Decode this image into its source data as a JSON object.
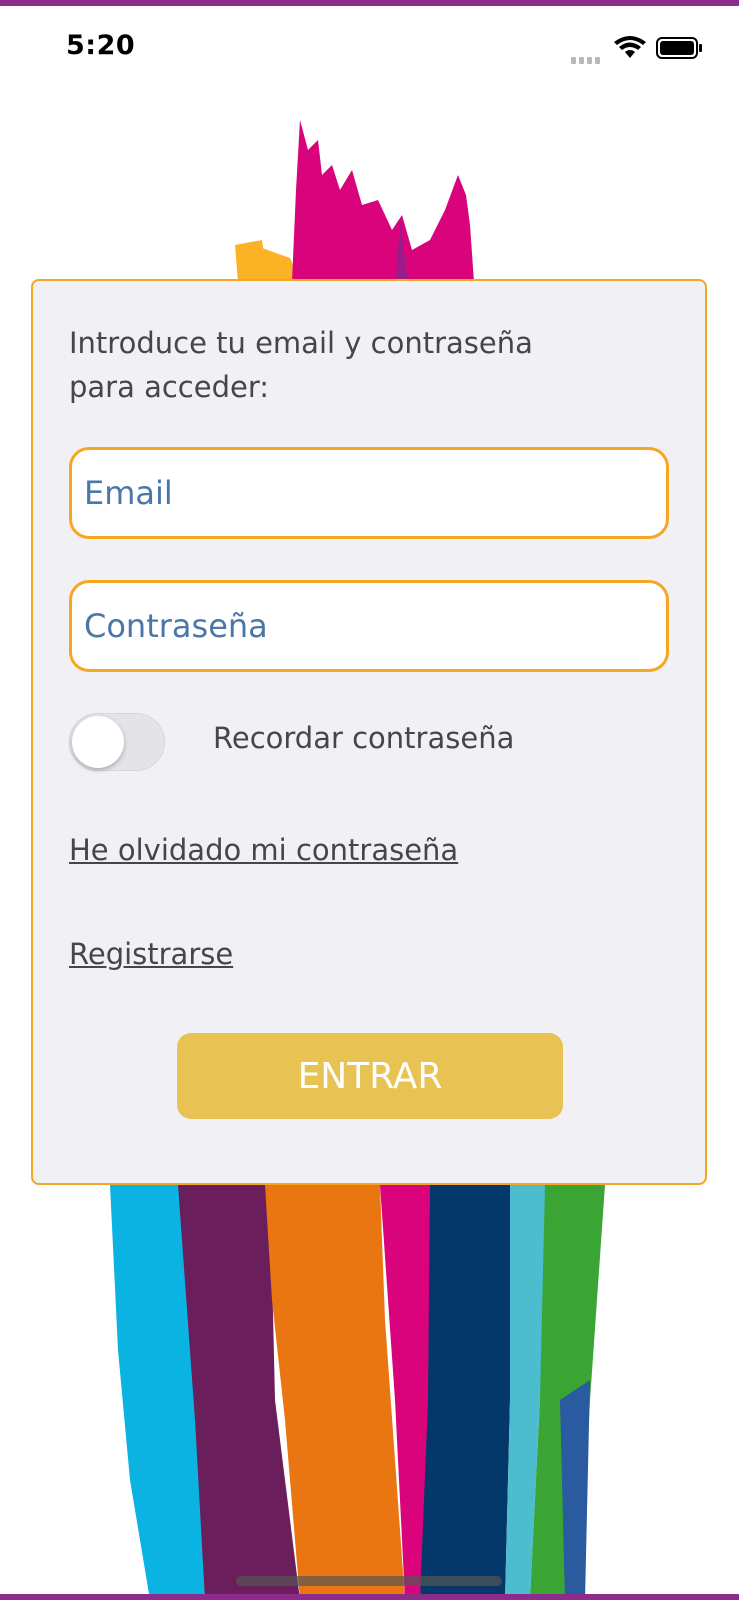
{
  "status_bar": {
    "time": "5:20"
  },
  "login": {
    "intro": "Introduce tu email y contraseña para acceder:",
    "email_placeholder": "Email",
    "password_placeholder": "Contraseña",
    "remember_label": "Recordar contraseña",
    "remember_on": false,
    "forgot_link": "He olvidado mi contraseña",
    "register_link": "Registrarse",
    "enter_button": "ENTRAR"
  },
  "colors": {
    "accent_border": "#f5a623",
    "button": "#e8c253",
    "frame": "#8e2a8c",
    "placeholder": "#4a77a8"
  },
  "icons": [
    "signal-icon",
    "wifi-icon",
    "battery-icon"
  ]
}
